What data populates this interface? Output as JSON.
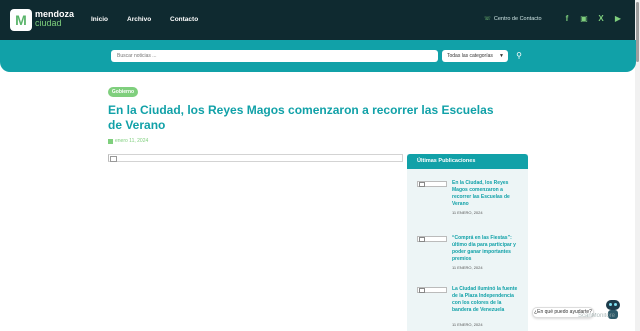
{
  "header": {
    "logo_letter": "M",
    "brand_line1": "mendoza",
    "brand_line2": "ciudad",
    "nav": [
      "Inicio",
      "Archivo",
      "Contacto"
    ],
    "contact_label": "Centro de Contacto",
    "social_icons": [
      "facebook-icon",
      "instagram-icon",
      "x-icon",
      "youtube-icon"
    ]
  },
  "search": {
    "placeholder": "Buscar noticias ...",
    "category": "Todas las categorías"
  },
  "article": {
    "category_badge": "Gobierno",
    "title": "En la Ciudad, los Reyes Magos comenzaron a recorrer las Escuelas de Verano",
    "date": "enero 11, 2024"
  },
  "sidebar": {
    "heading": "Últimas Publicaciones",
    "posts": [
      {
        "title": "En la Ciudad, los Reyes Magos comenzaron a recorrer las Escuelas de Verano",
        "date": "11 ENERO, 2024"
      },
      {
        "title": "“Comprá en las Fiestas”: último día para participar y poder ganar importantes premios",
        "date": "11 ENERO, 2024"
      },
      {
        "title": "La Ciudad iluminó la fuente de la Plaza Independencia con los colores de la bandera de Venezuela",
        "date": "11 ENERO, 2024"
      }
    ]
  },
  "chat": {
    "prompt": "¿En qué puedo ayudarte?"
  },
  "watermark": "ScanMonitore",
  "colors": {
    "dark": "#0f2a30",
    "teal": "#11a1a8",
    "green": "#7fcf7d"
  }
}
